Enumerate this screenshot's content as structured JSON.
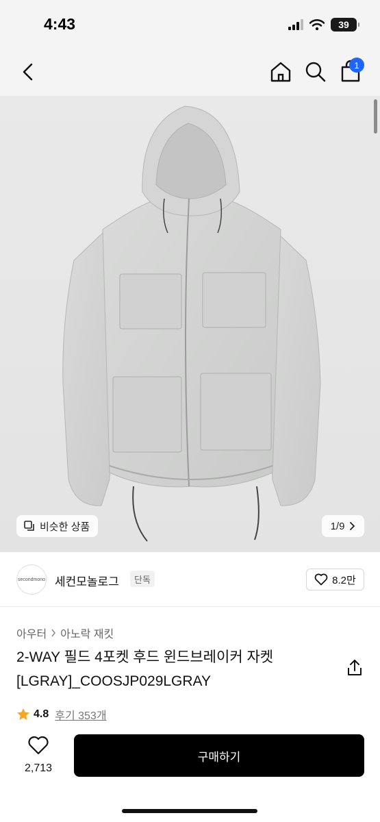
{
  "status_bar": {
    "time": "4:43",
    "battery_level": "39"
  },
  "nav": {
    "cart_badge": "1"
  },
  "hero": {
    "similar_label": "비슷한 상품",
    "page_indicator": "1/9"
  },
  "shop": {
    "logo_text": "secondmono",
    "name": "세컨모놀로그",
    "badge": "단독",
    "likes": "8.2만"
  },
  "product": {
    "breadcrumb": [
      "아우터",
      "아노락 재킷"
    ],
    "title": "2-WAY 필드 4포켓 후드 윈드브레이커 자켓 [LGRAY]_COOSJP029LGRAY",
    "rating": "4.8",
    "reviews": "후기 353개"
  },
  "footer": {
    "wish_count": "2,713",
    "buy_label": "구매하기"
  },
  "colors": {
    "accent": "#1e66ff",
    "star": "#f5a623",
    "button": "#000000"
  }
}
